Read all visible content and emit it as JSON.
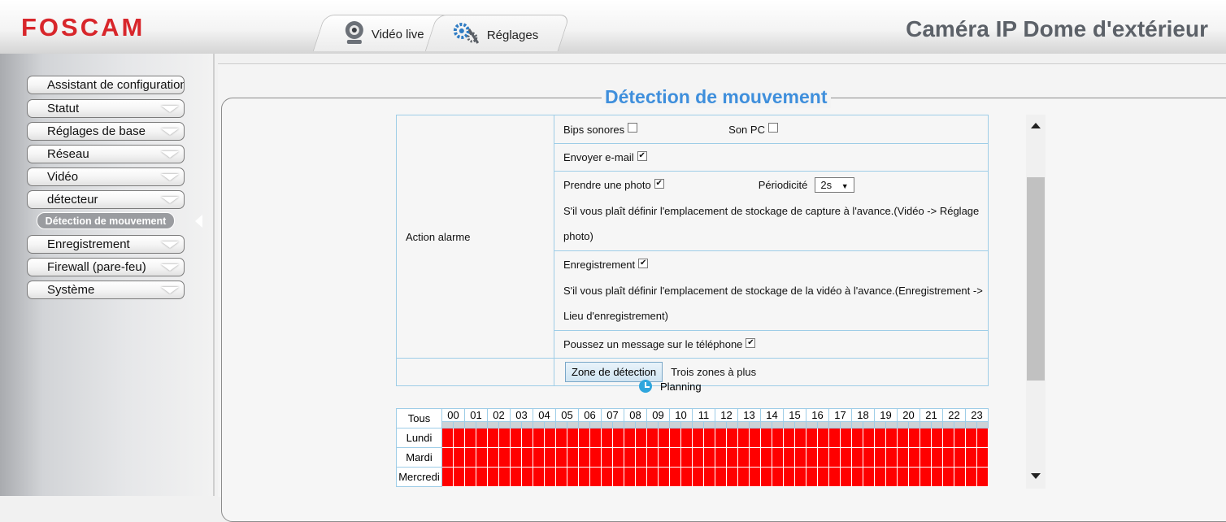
{
  "header": {
    "logo": "FOSCAM",
    "device_title": "Caméra IP Dome d'extérieur",
    "tabs": [
      {
        "label": "Vidéo live",
        "icon": "webcam-icon"
      },
      {
        "label": "Réglages",
        "icon": "gears-icon"
      }
    ]
  },
  "sidebar": {
    "items": [
      {
        "label": "Assistant de configuration"
      },
      {
        "label": "Statut"
      },
      {
        "label": "Réglages de base"
      },
      {
        "label": "Réseau"
      },
      {
        "label": "Vidéo"
      },
      {
        "label": "détecteur"
      },
      {
        "label": "Enregistrement"
      },
      {
        "label": "Firewall (pare-feu)"
      },
      {
        "label": "Système"
      }
    ],
    "active_subitem": "Détection de mouvement"
  },
  "main": {
    "title": "Détection de mouvement",
    "action_label": "Action alarme",
    "beep_label": "Bips sonores",
    "beep_checked": false,
    "pc_sound_label": "Son PC",
    "pc_sound_checked": false,
    "email_label": "Envoyer e-mail",
    "email_checked": true,
    "photo_label": "Prendre une photo",
    "photo_checked": true,
    "period_label": "Périodicité",
    "period_value": "2s",
    "photo_note": "S'il vous plaît définir l'emplacement de stockage de capture à l'avance.(Vidéo -> Réglage photo)",
    "record_label": "Enregistrement",
    "record_checked": true,
    "record_note": "S'il vous plaît définir l'emplacement de stockage de la vidéo à l'avance.(Enregistrement -> Lieu d'enregistrement)",
    "push_label": "Poussez un message sur le téléphone",
    "push_checked": true,
    "zone_button": "Zone de détection",
    "zone_note": "Trois zones à plus",
    "planning_label": "Planning",
    "schedule": {
      "all_label": "Tous",
      "hours": [
        "00",
        "01",
        "02",
        "03",
        "04",
        "05",
        "06",
        "07",
        "08",
        "09",
        "10",
        "11",
        "12",
        "13",
        "14",
        "15",
        "16",
        "17",
        "18",
        "19",
        "20",
        "21",
        "22",
        "23"
      ],
      "days": [
        "Lundi",
        "Mardi",
        "Mercredi"
      ],
      "active_color": "#ff0000"
    }
  }
}
